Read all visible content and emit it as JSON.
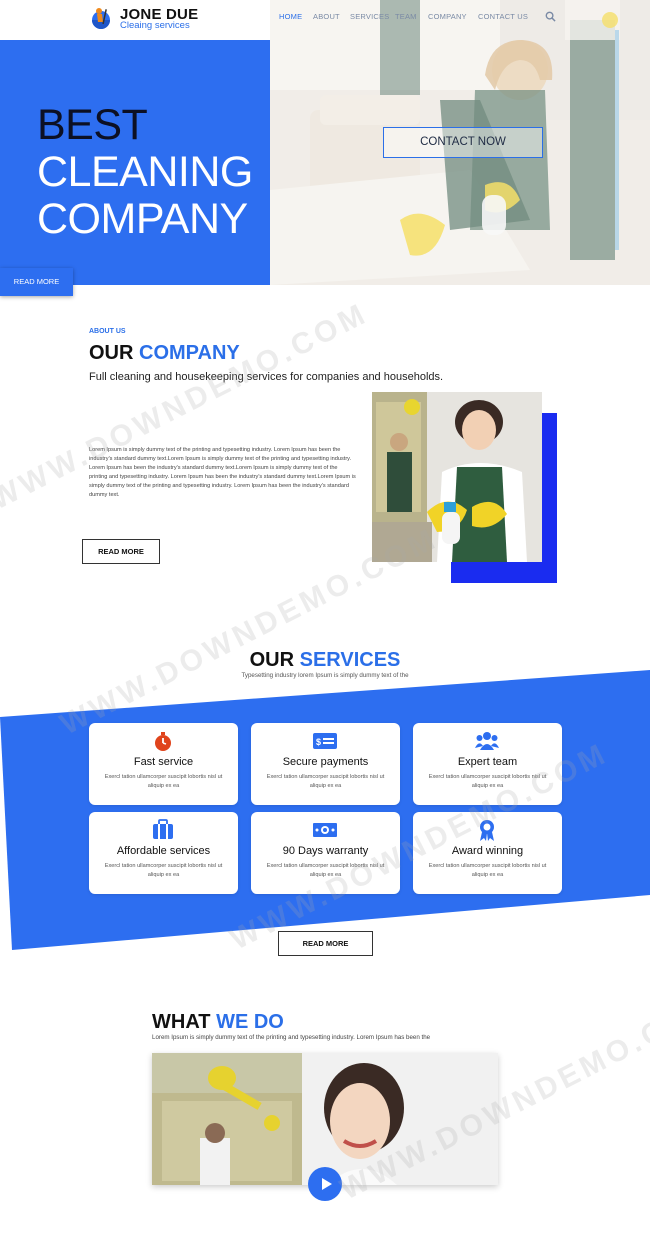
{
  "header": {
    "logo_title": "JONE DUE",
    "logo_subtitle": "Cleaing services",
    "nav": [
      {
        "label": "HOME",
        "active": true
      },
      {
        "label": "ABOUT"
      },
      {
        "label": "SERVICES"
      },
      {
        "label": "TEAM"
      },
      {
        "label": "COMPANY"
      },
      {
        "label": "CONTACT US"
      }
    ],
    "search_icon": "search-icon"
  },
  "hero": {
    "line1": "BEST",
    "line2": "CLEANING",
    "line3": "COMPANY",
    "read_more": "READ MORE",
    "contact_button": "CONTACT NOW"
  },
  "about": {
    "eyebrow": "ABOUT US",
    "heading_part1": "OUR",
    "heading_part2": "COMPANY",
    "lead": "Full cleaning and housekeeping services for companies and households.",
    "paragraph": "Lorem Ipsum is simply dummy text of the printing and typesetting industry. Lorem Ipsum has been the industry's standard dummy text.Lorem Ipsum is simply dummy text of the printing and typesetting industry. Lorem Ipsum has been the industry's standard dummy text.Lorem Ipsum is simply dummy text of the printing and typesetting industry. Lorem Ipsum has been the industry's standard dummy text.Lorem Ipsum is simply dummy text of the printing and typesetting industry. Lorem Ipsum has been the industry's standard dummy text.",
    "read_more": "READ MORE"
  },
  "services": {
    "heading_part1": "OUR",
    "heading_part2": "SERVICES",
    "subtitle": "Typesetting industry lorem Ipsum is simply dummy text of the",
    "items": [
      {
        "title": "Fast service",
        "desc": "Exercl tation ullamcorper suscipit lobortis nisl ut aliquip ex ea",
        "icon": "stopwatch-icon"
      },
      {
        "title": "Secure payments",
        "desc": "Exercl tation ullamcorper suscipit lobortis nisl ut aliquip ex ea",
        "icon": "card-icon"
      },
      {
        "title": "Expert team",
        "desc": "Exercl tation ullamcorper suscipit lobortis nisl ut aliquip ex ea",
        "icon": "team-icon"
      },
      {
        "title": "Affordable services",
        "desc": "Exercl tation ullamcorper suscipit lobortis nisl ut aliquip ex ea",
        "icon": "briefcase-icon"
      },
      {
        "title": "90 Days warranty",
        "desc": "Exercl tation ullamcorper suscipit lobortis nisl ut aliquip ex ea",
        "icon": "banknote-icon"
      },
      {
        "title": "Award winning",
        "desc": "Exercl tation ullamcorper suscipit lobortis nisl ut aliquip ex ea",
        "icon": "award-icon"
      }
    ],
    "read_more": "READ MORE"
  },
  "what_we_do": {
    "heading_part1": "WHAT",
    "heading_part2": "WE DO",
    "subtitle": "Lorem Ipsum is simply dummy text of the printing and typesetting industry. Lorem Ipsum has been the",
    "play_icon": "play-icon"
  },
  "watermark": "WWW.DOWNDEMO.COM",
  "colors": {
    "accent": "#2d6ef0",
    "deep_blue": "#1a2cf0",
    "stopwatch": "#e0441c"
  }
}
